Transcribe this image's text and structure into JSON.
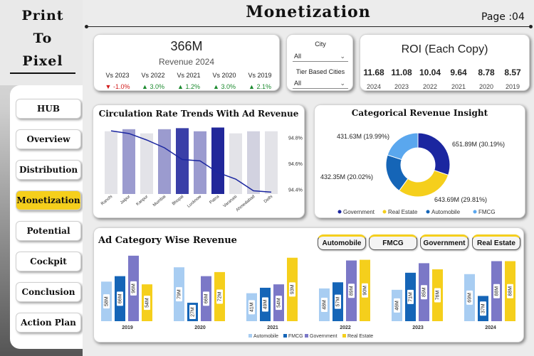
{
  "logo": {
    "line1": "Print",
    "line2": "To",
    "line3": "Pixel"
  },
  "nav": [
    "HUB",
    "Overview",
    "Distribution",
    "Monetization",
    "Potential",
    "Cockpit",
    "Conclusion",
    "Action Plan"
  ],
  "page": {
    "title": "Monetization",
    "page_label": "Page :04"
  },
  "revenue_kpi": {
    "value": "366M",
    "label": "Revenue 2024",
    "comparisons": [
      {
        "label": "Vs 2023",
        "value": "-1.0%",
        "direction": "down"
      },
      {
        "label": "Vs 2022",
        "value": "3.0%",
        "direction": "up"
      },
      {
        "label": "Vs 2021",
        "value": "1.2%",
        "direction": "up"
      },
      {
        "label": "Vs 2020",
        "value": "3.0%",
        "direction": "up"
      },
      {
        "label": "Vs 2019",
        "value": "2.1%",
        "direction": "up"
      }
    ]
  },
  "slicers": {
    "city_label": "City",
    "city_value": "All",
    "tier_label": "Tier Based Cities",
    "tier_value": "All"
  },
  "roi": {
    "title": "ROI (Each Copy)",
    "items": [
      {
        "value": "11.68",
        "year": "2024"
      },
      {
        "value": "11.08",
        "year": "2023"
      },
      {
        "value": "10.04",
        "year": "2022"
      },
      {
        "value": "9.64",
        "year": "2021"
      },
      {
        "value": "8.78",
        "year": "2020"
      },
      {
        "value": "8.57",
        "year": "2019"
      }
    ]
  },
  "colors": {
    "automobile": "#a8cdf2",
    "fmcg": "#1565b7",
    "government": "#7b78c7",
    "real_estate": "#f5cf1c",
    "accent": "#f5cf1c"
  },
  "chart_data": [
    {
      "type": "bar",
      "title": "Circulation Rate Trends With Ad Revenue",
      "categories": [
        "Ranchi",
        "Jaipur",
        "Kanpur",
        "Mumbai",
        "Bhopal",
        "Lucknow",
        "Patna",
        "Varanasi",
        "Ahmedabad",
        "Delhi"
      ],
      "series": [
        {
          "values": [
            30,
            31,
            29,
            31,
            31.5,
            30,
            31.8,
            29,
            30,
            30
          ],
          "colors": [
            "#e3e3e8",
            "#9b9bcf",
            "#e3e3e8",
            "#9b9bcf",
            "#3a3fa8",
            "#9b9bcf",
            "#21279a",
            "#e3e3e8",
            "#d2d2e0",
            "#e3e3e8"
          ]
        },
        {
          "type": "line",
          "values": [
            94.85,
            94.83,
            94.78,
            94.72,
            94.63,
            94.62,
            94.53,
            94.48,
            94.39,
            94.38
          ]
        }
      ],
      "secondary_axis": {
        "ticks": [
          "94.8%",
          "94.6%",
          "94.4%"
        ],
        "ticks_num": [
          94.8,
          94.6,
          94.4
        ],
        "range": [
          94.3,
          94.9
        ]
      },
      "bar_range": [
        0,
        34
      ]
    },
    {
      "type": "pie",
      "title": "Categorical Revenue Insight",
      "slices": [
        {
          "name": "Government",
          "value": 651.89,
          "label": "651.89M (30.19%)",
          "color": "#1b26a0"
        },
        {
          "name": "Real Estate",
          "value": 643.69,
          "label": "643.69M (29.81%)",
          "color": "#f5cf1c"
        },
        {
          "name": "Automobile",
          "value": 432.35,
          "label": "432.35M (20.02%)",
          "color": "#1565b7"
        },
        {
          "name": "FMCG",
          "value": 431.63,
          "label": "431.63M (19.99%)",
          "color": "#5aa7ee"
        }
      ],
      "legend": [
        "Government",
        "Real Estate",
        "Automobile",
        "FMCG"
      ]
    },
    {
      "type": "bar",
      "title": "Ad Category Wise Revenue",
      "categories": [
        "2019",
        "2020",
        "2021",
        "2022",
        "2023",
        "2024"
      ],
      "series": [
        {
          "name": "Automobile",
          "values": [
            58,
            79,
            41,
            48,
            46,
            69
          ]
        },
        {
          "name": "FMCG",
          "values": [
            66,
            27,
            49,
            57,
            71,
            37
          ]
        },
        {
          "name": "Government",
          "values": [
            96,
            66,
            54,
            89,
            85,
            88
          ]
        },
        {
          "name": "Real Estate",
          "values": [
            54,
            72,
            93,
            90,
            76,
            88
          ]
        }
      ],
      "ylim": [
        0,
        100
      ],
      "unit": "M"
    }
  ],
  "filters": [
    "Automobile",
    "FMCG",
    "Government",
    "Real Estate"
  ]
}
